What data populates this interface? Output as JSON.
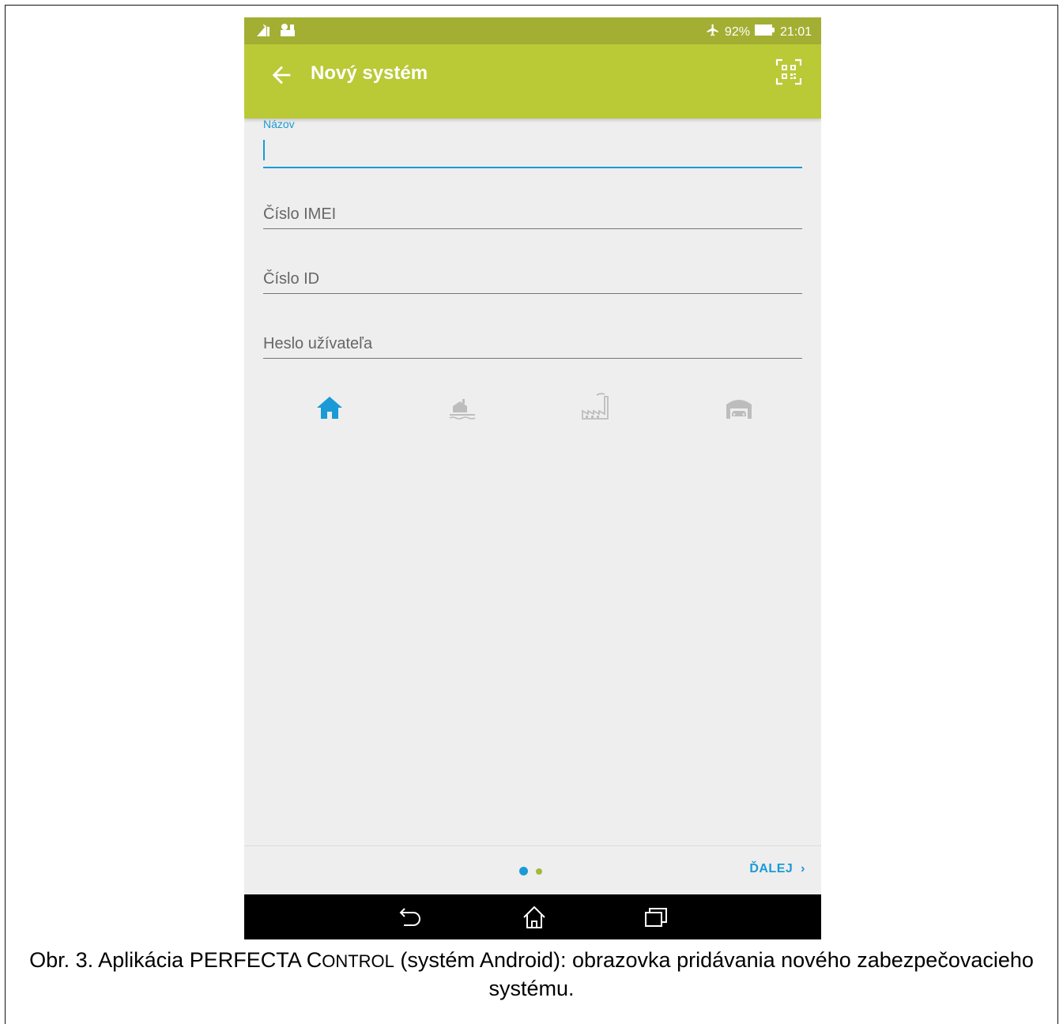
{
  "status_bar": {
    "battery_percent": "92%",
    "time": "21:01",
    "icons": [
      "notification-icon",
      "vpn-icon",
      "airplane-mode-icon",
      "battery-icon"
    ]
  },
  "app_bar": {
    "title": "Nový systém",
    "back_icon": "arrow-left-icon",
    "qr_icon": "qr-code-scan-icon"
  },
  "form": {
    "name_label": "Názov",
    "imei_placeholder": "Číslo IMEI",
    "id_placeholder": "Číslo ID",
    "password_placeholder": "Heslo užívateľa"
  },
  "system_types": [
    {
      "icon": "house-icon",
      "selected": true
    },
    {
      "icon": "lake-house-icon",
      "selected": false
    },
    {
      "icon": "factory-icon",
      "selected": false
    },
    {
      "icon": "garage-icon",
      "selected": false
    }
  ],
  "pager": {
    "next_label": "ĎALEJ",
    "page": 1,
    "page_count": 2
  },
  "nav": [
    "back-icon",
    "home-icon",
    "recent-apps-icon"
  ],
  "colors": {
    "status_bar": "#a2af33",
    "app_bar": "#bac936",
    "accent": "#1a9ad6",
    "inactive_icon": "#bdbdbd"
  },
  "caption": {
    "part1": "Obr. 3. Aplikácia PERFECTA C",
    "part2": "ONTROL",
    "part3": " (systém Android): obrazovka pridávania nového zabezpečovacieho systému."
  }
}
